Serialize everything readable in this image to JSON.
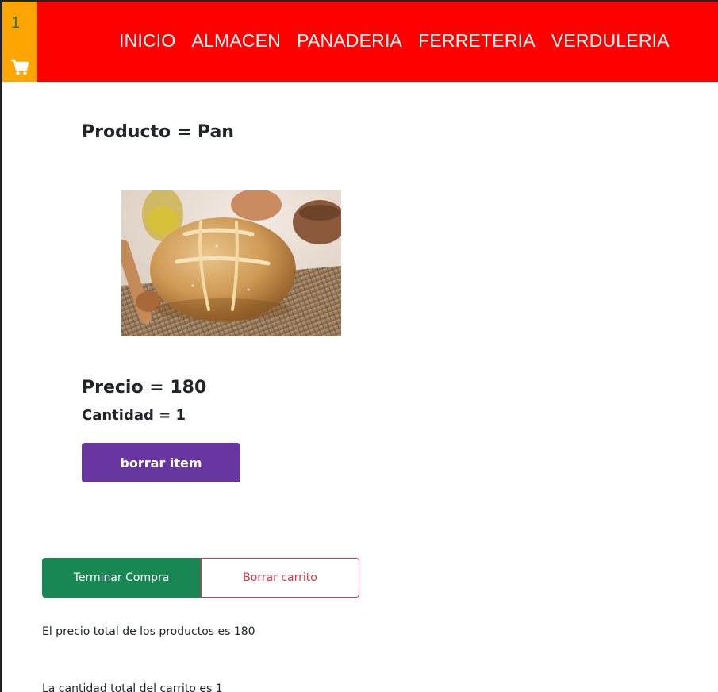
{
  "cart": {
    "count": "1",
    "icon": "shopping-cart-icon"
  },
  "nav": {
    "items": [
      {
        "label": "INICIO"
      },
      {
        "label": "ALMACEN"
      },
      {
        "label": "PANADERIA"
      },
      {
        "label": "FERRETERIA"
      },
      {
        "label": "VERDULERIA"
      }
    ]
  },
  "product": {
    "title": "Producto = Pan",
    "image_alt": "Pan",
    "price": "Precio = 180",
    "quantity": "Cantidad = 1",
    "delete_label": "borrar item"
  },
  "actions": {
    "finish_label": "Terminar Compra",
    "clear_label": "Borrar carrito"
  },
  "summary": {
    "total_price": "El precio total de los productos es 180",
    "total_quantity": "La cantidad total del carrito es 1"
  },
  "colors": {
    "header_bg": "#ff0000",
    "cart_bg": "#ffa500",
    "cart_count": "#1f7a1f",
    "delete_button": "#6836a0",
    "finish_button": "#198754",
    "clear_button": "#dc3545"
  }
}
